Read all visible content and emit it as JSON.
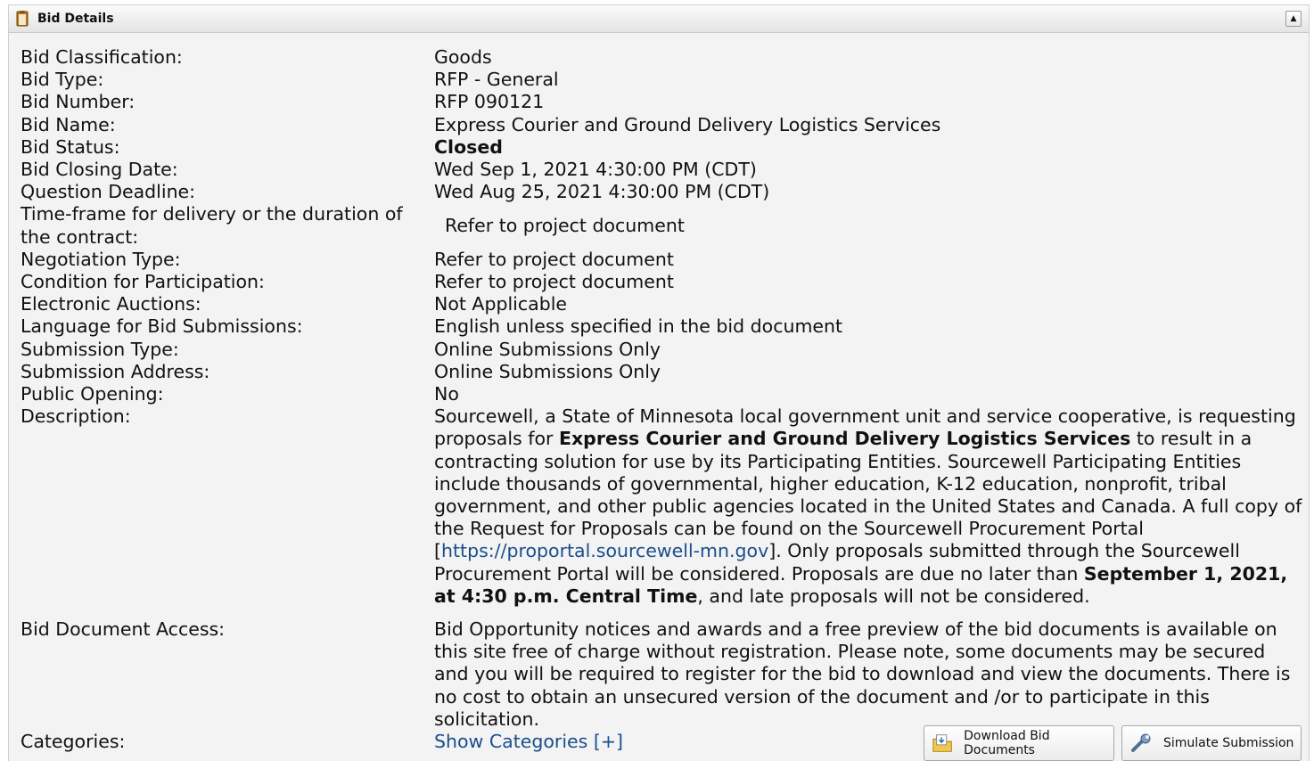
{
  "header": {
    "title": "Bid Details",
    "collapse_symbol": "▲"
  },
  "fields": {
    "classification": {
      "label": "Bid Classification:",
      "value": "Goods"
    },
    "type": {
      "label": "Bid Type:",
      "value": "RFP - General"
    },
    "number": {
      "label": "Bid Number:",
      "value": "RFP 090121"
    },
    "name": {
      "label": "Bid Name:",
      "value": "Express Courier and Ground Delivery Logistics Services"
    },
    "status": {
      "label": "Bid Status:",
      "value": "Closed"
    },
    "closing_date": {
      "label": "Bid Closing Date:",
      "value": "Wed Sep 1, 2021 4:30:00 PM (CDT)"
    },
    "question_deadline": {
      "label": "Question Deadline:",
      "value": "Wed Aug 25, 2021 4:30:00 PM (CDT)"
    },
    "timeframe": {
      "label": "Time-frame for delivery or the duration of the contract:",
      "value": "Refer to project document"
    },
    "negotiation": {
      "label": "Negotiation Type:",
      "value": "Refer to project document"
    },
    "condition": {
      "label": "Condition for Participation:",
      "value": "Refer to project document"
    },
    "auctions": {
      "label": "Electronic Auctions:",
      "value": "Not Applicable"
    },
    "language": {
      "label": "Language for Bid Submissions:",
      "value": "English unless specified in the bid document"
    },
    "submission_type": {
      "label": "Submission Type:",
      "value": "Online Submissions Only"
    },
    "submission_address": {
      "label": "Submission Address:",
      "value": "Online Submissions Only"
    },
    "public_opening": {
      "label": "Public Opening:",
      "value": "No"
    },
    "description": {
      "label": "Description:",
      "p1": "Sourcewell, a State of Minnesota local government unit and service cooperative, is requesting proposals for ",
      "b1": "Express Courier and Ground Delivery Logistics Services",
      "p2": " to result in a contracting solution for use by its Participating Entities. Sourcewell Participating Entities include thousands of governmental, higher education, K-12 education, nonprofit, tribal government, and other public agencies located in the United States and Canada. A full copy of the Request for Proposals can be found on the Sourcewell Procurement Portal [",
      "link": "https://proportal.sourcewell-mn.gov",
      "p3": "]. Only proposals submitted through the Sourcewell Procurement Portal will be considered. Proposals are due no later than ",
      "b2": "September 1, 2021, at 4:30 p.m. Central Time",
      "p4": ", and late proposals will not be considered."
    },
    "document_access": {
      "label": "Bid Document Access:",
      "value": "Bid Opportunity notices and awards and a free preview of the bid documents is available on this site free of charge without registration. Please note, some documents may be secured and you will be required to register for the bid to download and view the documents. There is no cost to obtain an unsecured version of the document and /or to participate in this solicitation."
    },
    "categories": {
      "label": "Categories:",
      "link": "Show Categories [+]"
    }
  },
  "buttons": {
    "download": {
      "label": "Download Bid Documents",
      "icon": "folder-download-icon"
    },
    "simulate": {
      "label": "Simulate Submission",
      "icon": "wrench-icon"
    }
  },
  "colors": {
    "link": "#1a4e8c",
    "panel_bg": "#f3f3f3",
    "header_bg": "#e4e4e4"
  }
}
